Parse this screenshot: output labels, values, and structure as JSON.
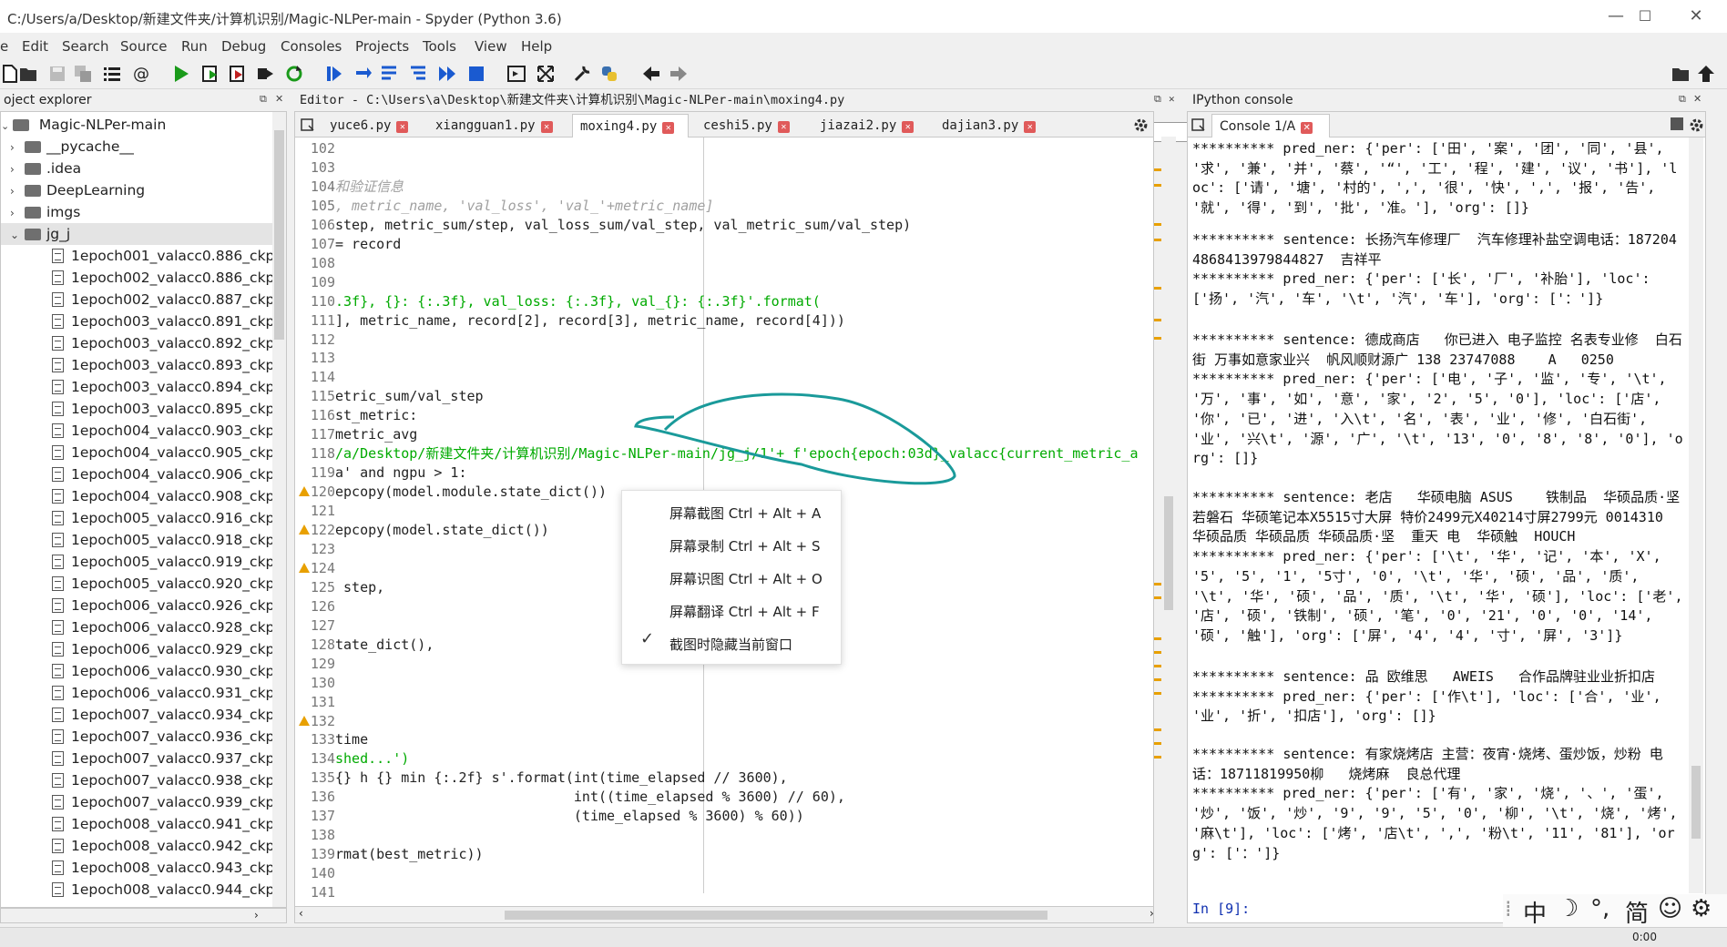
{
  "window": {
    "title": "C:/Users/a/Desktop/新建文件夹/计算机识别/Magic-NLPer-main - Spyder (Python 3.6)"
  },
  "menu": [
    "e",
    "Edit",
    "Search",
    "Source",
    "Run",
    "Debug",
    "Consoles",
    "Projects",
    "Tools",
    "View",
    "Help"
  ],
  "toolbar": {
    "path": "C:\\Users\\a\\Desktop\\新建文件夹\\计算机识别\\Magic-NLPer-main"
  },
  "explorer": {
    "header": "oject explorer",
    "root": "Magic-NLPer-main",
    "folders": [
      "__pycache__",
      ".idea",
      "DeepLearning",
      "imgs",
      "jg_j"
    ],
    "files": [
      "1epoch001_valacc0.886_ckpt.",
      "1epoch002_valacc0.886_ckpt.",
      "1epoch002_valacc0.887_ckpt.",
      "1epoch003_valacc0.891_ckpt.",
      "1epoch003_valacc0.892_ckpt.",
      "1epoch003_valacc0.893_ckpt.",
      "1epoch003_valacc0.894_ckpt.",
      "1epoch003_valacc0.895_ckpt.",
      "1epoch004_valacc0.903_ckpt.",
      "1epoch004_valacc0.905_ckpt.",
      "1epoch004_valacc0.906_ckpt.",
      "1epoch004_valacc0.908_ckpt.",
      "1epoch005_valacc0.916_ckpt.",
      "1epoch005_valacc0.918_ckpt.",
      "1epoch005_valacc0.919_ckpt.",
      "1epoch005_valacc0.920_ckpt.",
      "1epoch006_valacc0.926_ckpt.",
      "1epoch006_valacc0.928_ckpt.",
      "1epoch006_valacc0.929_ckpt.",
      "1epoch006_valacc0.930_ckpt.",
      "1epoch006_valacc0.931_ckpt.",
      "1epoch007_valacc0.934_ckpt.",
      "1epoch007_valacc0.936_ckpt.",
      "1epoch007_valacc0.937_ckpt.",
      "1epoch007_valacc0.938_ckpt.",
      "1epoch007_valacc0.939_ckpt.",
      "1epoch008_valacc0.941_ckpt.",
      "1epoch008_valacc0.942_ckpt.",
      "1epoch008_valacc0.943_ckpt.",
      "1epoch008_valacc0.944_ckpt."
    ]
  },
  "editor": {
    "header": "Editor - C:\\Users\\a\\Desktop\\新建文件夹\\计算机识别\\Magic-NLPer-main\\moxing4.py",
    "tabs": [
      "yuce6.py",
      "xiangguan1.py",
      "moxing4.py",
      "ceshi5.py",
      "jiazai2.py",
      "dajian3.py"
    ],
    "active_tab": "moxing4.py",
    "lines": [
      {
        "n": "102",
        "t": ""
      },
      {
        "n": "103",
        "t": ""
      },
      {
        "n": "104",
        "t": "和验证信息",
        "cls": "cmt"
      },
      {
        "n": "105",
        "t": ", metric_name, 'val_loss', 'val_'+metric_name]",
        "cls": "cmt"
      },
      {
        "n": "106",
        "t": "step, metric_sum/step, val_loss_sum/val_step, val_metric_sum/val_step)"
      },
      {
        "n": "107",
        "t": "= record"
      },
      {
        "n": "108",
        "t": ""
      },
      {
        "n": "109",
        "t": ""
      },
      {
        "n": "110",
        "t": ".3f}, {}: {:.3f}, val_loss: {:.3f}, val_{}: {:.3f}'.format(",
        "cls": "str"
      },
      {
        "n": "111",
        "t": "], metric_name, record[2], record[3], metric_name, record[4]))"
      },
      {
        "n": "112",
        "t": ""
      },
      {
        "n": "113",
        "t": ""
      },
      {
        "n": "114",
        "t": ""
      },
      {
        "n": "115",
        "t": "etric_sum/val_step"
      },
      {
        "n": "116",
        "t": "st_metric:"
      },
      {
        "n": "117",
        "t": "metric_avg"
      },
      {
        "n": "118",
        "t": "/a/Desktop/新建文件夹/计算机识别/Magic-NLPer-main/jg_j/1'+ f'epoch{epoch:03d}_valacc{current_metric_a",
        "cls": "str"
      },
      {
        "n": "119",
        "t": "a' and ngpu > 1:"
      },
      {
        "n": "120",
        "t": "epcopy(model.module.state_dict())",
        "warn": true
      },
      {
        "n": "121",
        "t": ""
      },
      {
        "n": "122",
        "t": "epcopy(model.state_dict())",
        "warn": true
      },
      {
        "n": "123",
        "t": ""
      },
      {
        "n": "124",
        "t": "",
        "warn": true
      },
      {
        "n": "125",
        "t": " step,"
      },
      {
        "n": "126",
        "t": ""
      },
      {
        "n": "127",
        "t": ""
      },
      {
        "n": "128",
        "t": "tate_dict(),"
      },
      {
        "n": "129",
        "t": ""
      },
      {
        "n": "130",
        "t": ""
      },
      {
        "n": "131",
        "t": ""
      },
      {
        "n": "132",
        "t": "",
        "warn": true
      },
      {
        "n": "133",
        "t": "time"
      },
      {
        "n": "134",
        "t": "shed...')",
        "cls": "str"
      },
      {
        "n": "135",
        "t": "{} h {} min {:.2f} s'.format(int(time_elapsed // 3600),"
      },
      {
        "n": "136",
        "t": "                             int((time_elapsed % 3600) // 60),"
      },
      {
        "n": "137",
        "t": "                             (time_elapsed % 3600) % 60))"
      },
      {
        "n": "138",
        "t": ""
      },
      {
        "n": "139",
        "t": "rmat(best_metric))"
      },
      {
        "n": "140",
        "t": ""
      },
      {
        "n": "141",
        "t": ""
      },
      {
        "n": "142",
        "t": ""
      }
    ]
  },
  "console": {
    "header": "IPython console",
    "tab": "Console 1/A",
    "blocks": [
      "********** pred_ner: {'per': ['田', '案', '团', '同', '县', '求', '兼', '并', '蔡', '“', '工', '程', '建', '议', '书'], 'loc': ['请', '塘', '村的', ',', '很', '快', ',', '报', '告', '就', '得', '到', '批', '准。'], 'org': []}",
      "********** sentence: 长扬汽车修理厂  汽车修理补盐空调电话：18720448684139798448​27  吉祥平\n********** pred_ner: {'per': ['长', '厂', '补胎'], 'loc': ['扬', '汽', '车', '\\t', '汽', '车'], 'org': ['：']}",
      "********** sentence: 德成商店   你已进入 电子监控 名表专业修  白石街 万事如意家业兴  帆风顺财源广 138 23747088    A   0250\n********** pred_ner: {'per': ['电', '子', '监', '专', '\\t', '万', '事', '如', '意', '家', '2', '5', '0'], 'loc': ['店', '你', '已', '进', '入\\t', '名', '表', '业', '修', '白石街', '业', '兴\\t', '源', '广', '\\t', '13', '0', '8', '8', '0'], 'org': []}",
      "********** sentence: 老店   华硕电脑 ASUS    铁制品  华硕品质·坚若磐石 华硕笔记本X5515寸大屏 特价2499元X40214寸屏2799元 0014310 华硕品质 华硕品质 华硕品质·坚  重天 电  华硕触  HOUCH\n********** pred_ner: {'per': ['\\t', '华', '记', '本', 'X', '5', '5', '1', '5寸', '0', '\\t', '华', '硕', '品', '质', '\\t', '华', '硕', '品', '质', '\\t', '华', '硕'], 'loc': ['老', '店', '硕', '铁制', '硕', '笔', '0', '21', '0', '0', '14', '硕', '触'], 'org': ['屏', '4', '4', '寸', '屏', '3']}",
      "********** sentence: 品 欧维思   AWEIS   合作品牌驻业业折扣店\n********** pred_ner: {'per': ['作\\t'], 'loc': ['合', '业', '业', '折', '扣店'], 'org': []}",
      "********** sentence: 有家烧烤店 主营：夜宵·烧烤、蛋炒饭，炒粉 电话：18711819950柳   烧烤麻  良总代理\n********** pred_ner: {'per': ['有', '家', '烧', '、', '蛋', '炒', '饭', '炒', '9', '9', '5', '0', '柳', '\\t', '烧', '烤', '麻\\t'], 'loc': ['烤', '店\\t', ',', '粉\\t', '11', '81'], 'org': ['：']}"
    ],
    "prompt": "In [9]:"
  },
  "context_menu": {
    "items": [
      "屏幕截图 Ctrl + Alt + A",
      "屏幕录制 Ctrl + Alt + S",
      "屏幕识图 Ctrl + Alt + O",
      "屏幕翻译 Ctrl + Alt + F",
      "截图时隐藏当前窗口"
    ]
  },
  "ime": {
    "items": [
      "中",
      "°,",
      "简"
    ]
  },
  "taskbar": {
    "clock": "0:00"
  },
  "colors": {
    "accent": "#1a9a9a",
    "warn": "#e8a000",
    "string": "#00aa00",
    "keyword": "#0000c0",
    "number": "#c03030"
  }
}
